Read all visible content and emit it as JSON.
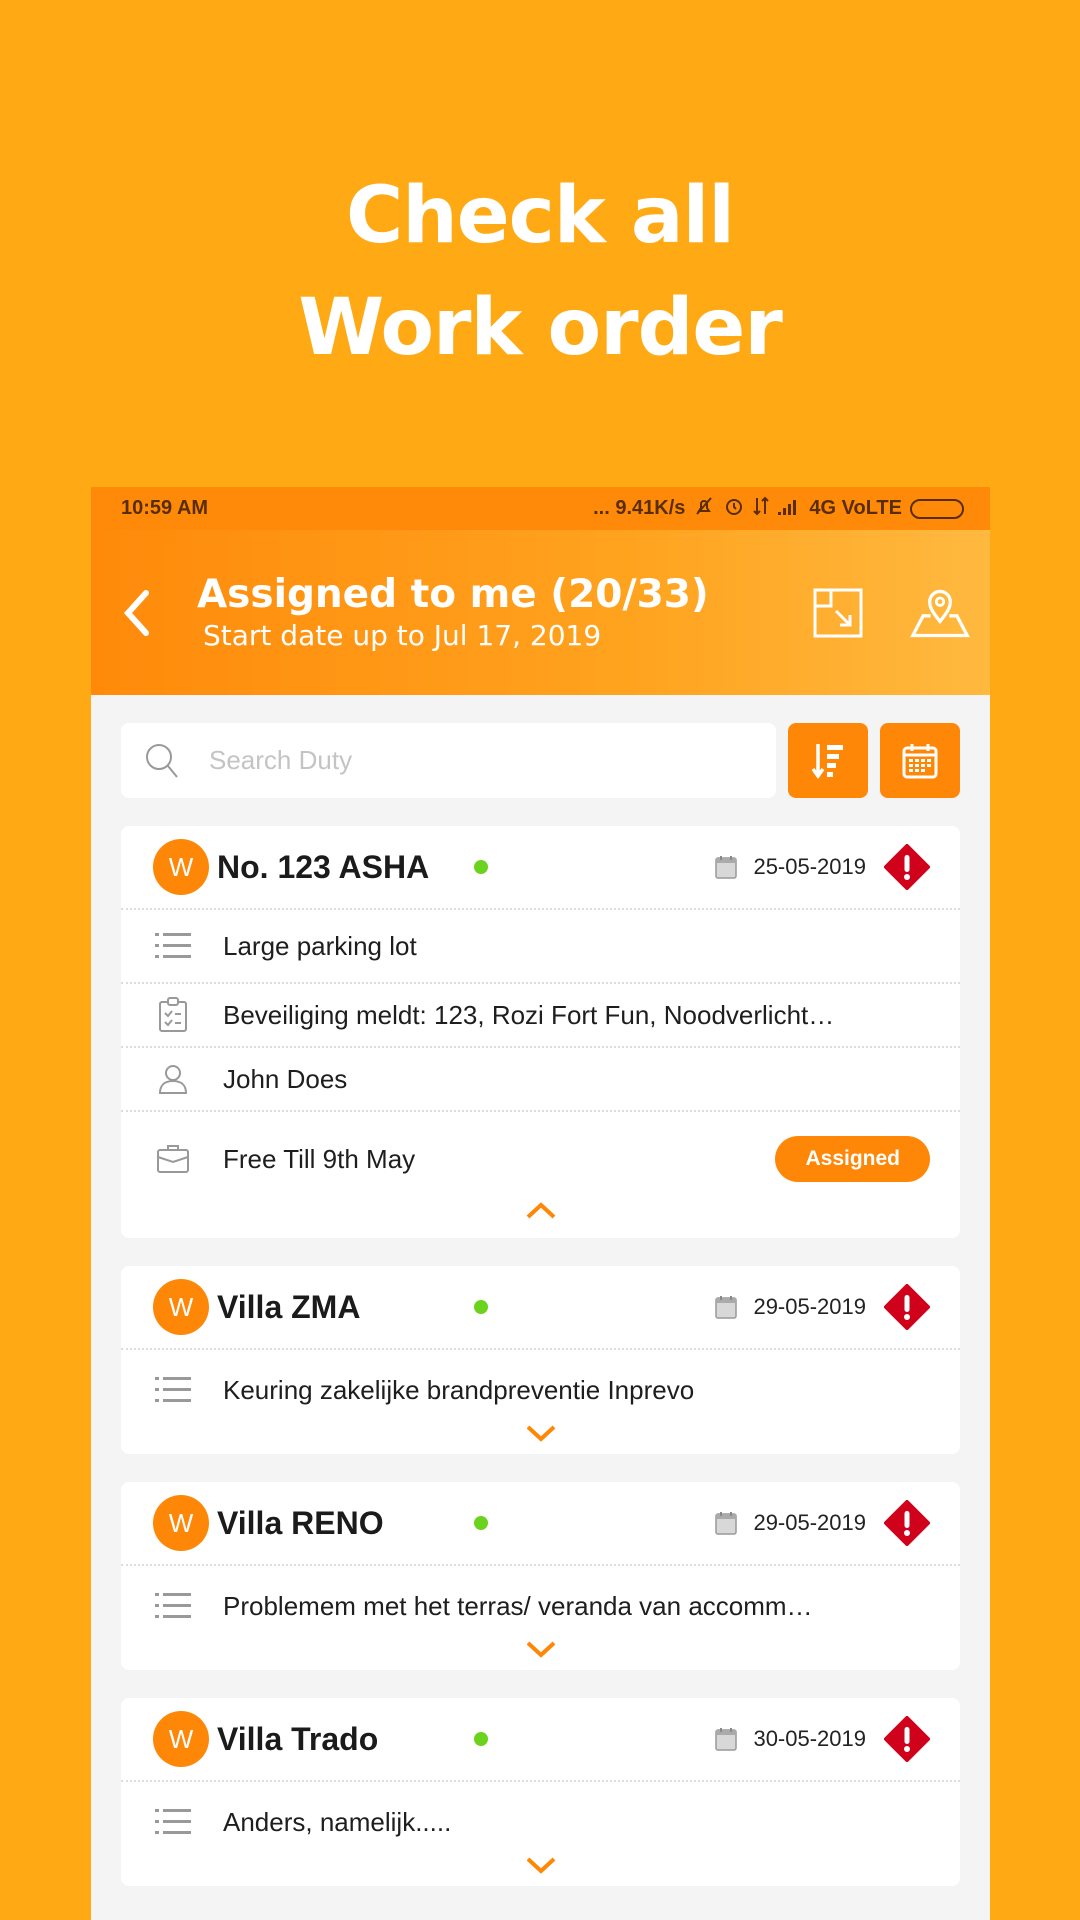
{
  "promo": {
    "line1": "Check all",
    "line2": "Work order"
  },
  "status_bar": {
    "time": "10:59 AM",
    "network_speed": "... 9.41K/s",
    "network_type": "4G VoLTE",
    "icons": [
      "mute-icon",
      "alarm-icon",
      "data-transfer-icon",
      "signal-icon",
      "battery-icon"
    ]
  },
  "header": {
    "title": "Assigned to me (20/33)",
    "subtitle": "Start date up to Jul 17, 2019",
    "actions": [
      "expand-icon",
      "map-pin-icon"
    ]
  },
  "search": {
    "placeholder": "Search Duty",
    "value": ""
  },
  "toolbar": {
    "buttons": [
      "sort-icon",
      "calendar-icon"
    ]
  },
  "colors": {
    "accent": "#FF8708",
    "background": "#FFA914",
    "status_dot": "#6BD21D",
    "alert": "#D0021B"
  },
  "work_orders": [
    {
      "avatar": "W",
      "name": "No. 123 ASHA",
      "date": "25-05-2019",
      "expanded": true,
      "description": "Large parking lot",
      "checklist": "Beveiliging meldt: 123, Rozi Fort Fun, Noodverlicht…",
      "person": "John Does",
      "availability": "Free Till 9th May",
      "status": "Assigned"
    },
    {
      "avatar": "W",
      "name": "Villa ZMA",
      "date": "29-05-2019",
      "expanded": false,
      "description": "Keuring zakelijke brandpreventie Inprevo"
    },
    {
      "avatar": "W",
      "name": "Villa RENO",
      "date": "29-05-2019",
      "expanded": false,
      "description": "Problemem met het terras/ veranda van accomm…"
    },
    {
      "avatar": "W",
      "name": "Villa Trado",
      "date": "30-05-2019",
      "expanded": false,
      "description": "Anders, namelijk....."
    }
  ]
}
